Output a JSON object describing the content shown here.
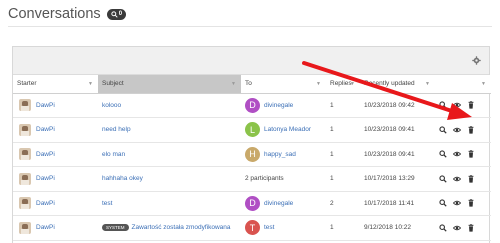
{
  "page": {
    "title": "Conversations",
    "badge_label": "0"
  },
  "colors": {
    "accent_link": "#3b6fb6",
    "arrow": "#e8181b",
    "sorted_header_bg": "#c7c7c7",
    "panel_bar_bg": "#f0f0f0"
  },
  "table": {
    "columns": [
      {
        "label": "Starter",
        "sort": "▼"
      },
      {
        "label": "Subject",
        "sort": "▼"
      },
      {
        "label": "To",
        "sort": "▼"
      },
      {
        "label": "Replies",
        "sort": "▼"
      },
      {
        "label": "Recently updated",
        "sort": "▼"
      },
      {
        "label": "",
        "sort": "▼"
      }
    ],
    "rows": [
      {
        "starter": "DawPi",
        "subject": "kolooo",
        "system": "",
        "to": "divinegale",
        "to_initial": "D",
        "to_color": "#b04fc4",
        "replies": "1",
        "updated": "10/23/2018 09:42"
      },
      {
        "starter": "DawPi",
        "subject": "need help",
        "system": "",
        "to": "Latonya Meador",
        "to_initial": "L",
        "to_color": "#8bc34a",
        "replies": "1",
        "updated": "10/23/2018 09:41"
      },
      {
        "starter": "DawPi",
        "subject": "elo man",
        "system": "",
        "to": "happy_sad",
        "to_initial": "H",
        "to_color": "#c9a96a",
        "replies": "1",
        "updated": "10/23/2018 09:41"
      },
      {
        "starter": "DawPi",
        "subject": "hahhaha okey",
        "system": "",
        "to": "2 participants",
        "to_initial": "",
        "to_color": "",
        "replies": "1",
        "updated": "10/17/2018 13:29"
      },
      {
        "starter": "DawPi",
        "subject": "test",
        "system": "",
        "to": "divinegale",
        "to_initial": "D",
        "to_color": "#b04fc4",
        "replies": "2",
        "updated": "10/17/2018 11:41"
      },
      {
        "starter": "DawPi",
        "subject": "Zawartość została zmodyfikowana",
        "system": "SYSTEM",
        "to": "test",
        "to_initial": "T",
        "to_color": "#d9534f",
        "replies": "1",
        "updated": "9/12/2018 10:22"
      }
    ]
  },
  "icons": {
    "badge": "search-icon",
    "panel": "gear-icon",
    "row_actions": [
      "search-icon",
      "eye-icon",
      "trash-icon"
    ]
  }
}
